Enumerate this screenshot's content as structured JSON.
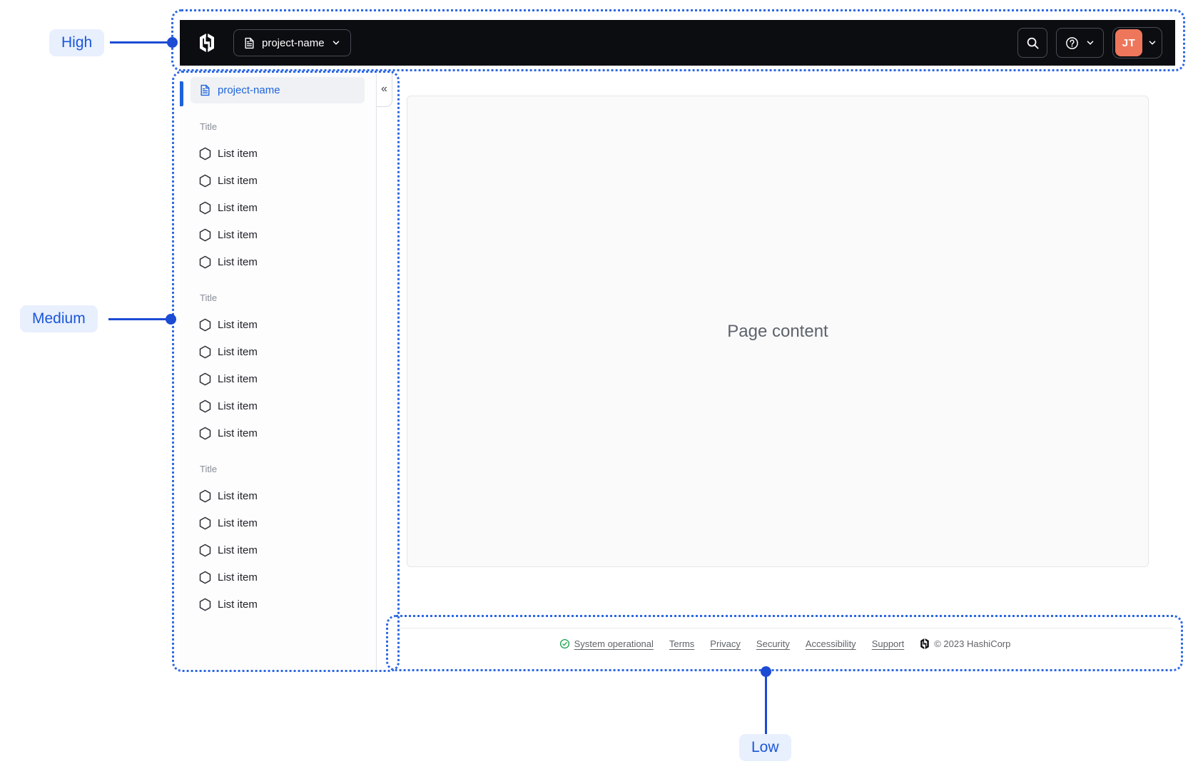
{
  "annotations": {
    "high": {
      "label": "High"
    },
    "medium": {
      "label": "Medium"
    },
    "low": {
      "label": "Low"
    }
  },
  "navbar": {
    "project_switcher": {
      "label": "project-name"
    },
    "search_icon": "magnifier",
    "help_icon": "question-mark-circle",
    "user": {
      "initials": "JT"
    }
  },
  "sidebar": {
    "header": {
      "label": "project-name"
    },
    "collapse_icon": "«",
    "groups": [
      {
        "title": "Title",
        "items": [
          "List item",
          "List item",
          "List item",
          "List item",
          "List item"
        ]
      },
      {
        "title": "Title",
        "items": [
          "List item",
          "List item",
          "List item",
          "List item",
          "List item"
        ]
      },
      {
        "title": "Title",
        "items": [
          "List item",
          "List item",
          "List item",
          "List item",
          "List item"
        ]
      }
    ]
  },
  "main": {
    "placeholder": "Page content"
  },
  "footer": {
    "status": {
      "label": "System operational",
      "icon": "check-circle"
    },
    "links": [
      "Terms",
      "Privacy",
      "Security",
      "Accessibility",
      "Support"
    ],
    "copyright": "© 2023 HashiCorp"
  },
  "colors": {
    "navbar_bg": "#0c0d11",
    "accent_blue": "#1c63dc",
    "annotation_blue": "#1c4bd4",
    "annotation_pill_bg": "#e8effd",
    "avatar_orange": "#ee765b",
    "status_green": "#18a04a",
    "sidebar_selected_bg": "#f0f1f4",
    "content_bg": "#fafafa"
  }
}
